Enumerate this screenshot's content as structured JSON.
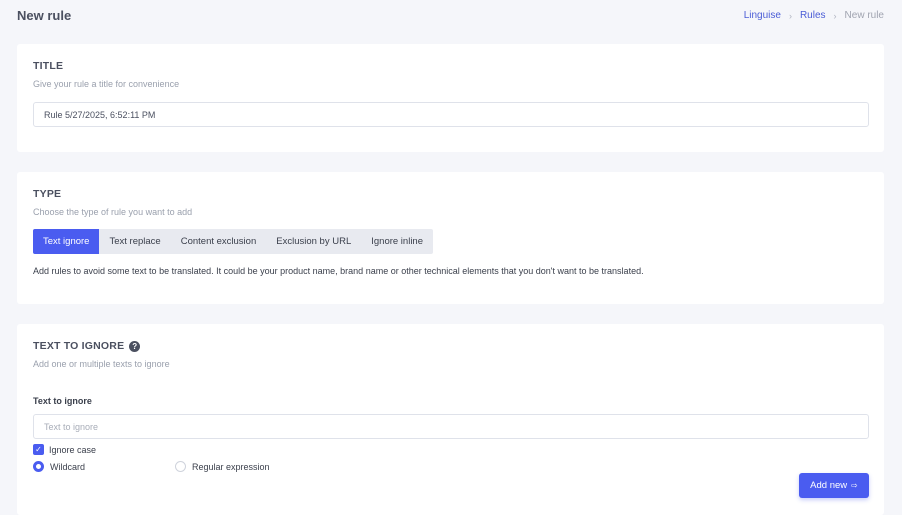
{
  "header": {
    "title": "New rule",
    "breadcrumb": [
      "Linguise",
      "Rules",
      "New rule"
    ]
  },
  "title_section": {
    "heading": "TITLE",
    "subtitle": "Give your rule a title for convenience",
    "input_value": "Rule 5/27/2025, 6:52:11 PM"
  },
  "type_section": {
    "heading": "TYPE",
    "subtitle": "Choose the type of rule you want to add",
    "tabs": [
      {
        "label": "Text ignore",
        "active": true
      },
      {
        "label": "Text replace",
        "active": false
      },
      {
        "label": "Content exclusion",
        "active": false
      },
      {
        "label": "Exclusion by URL",
        "active": false
      },
      {
        "label": "Ignore inline",
        "active": false
      }
    ],
    "description": "Add rules to avoid some text to be translated. It could be your product name, brand name or other technical elements that you don't want to be translated."
  },
  "ignore_section": {
    "heading": "TEXT TO IGNORE",
    "help_icon": "help-circle-icon",
    "subtitle": "Add one or multiple texts to ignore",
    "field_label": "Text to ignore",
    "input_placeholder": "Text to ignore",
    "input_value": "",
    "ignore_case_label": "Ignore case",
    "ignore_case_checked": true,
    "match_options": [
      {
        "label": "Wildcard",
        "selected": true
      },
      {
        "label": "Regular expression",
        "selected": false
      }
    ],
    "add_button_label": "Add new",
    "add_button_icon": "arrow-icon"
  },
  "colors": {
    "accent": "#4a5cf0",
    "link": "#4a5cd6",
    "background": "#f5f6fa"
  }
}
